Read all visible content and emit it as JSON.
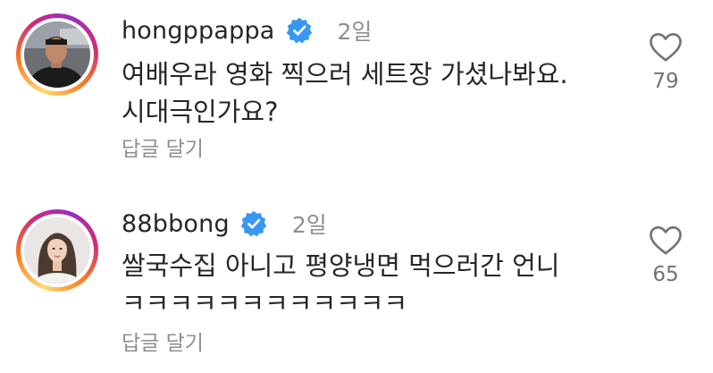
{
  "comments": [
    {
      "username": "hongppappa",
      "verified_icon": "verified-badge-icon",
      "time": "2일",
      "text_line1": "여배우라 영화 찍으러 세트장 가셨나봐요.",
      "text_line2": "시대극인가요?",
      "reply_label": "답글 달기",
      "like_icon": "heart-icon",
      "likes": "79"
    },
    {
      "username": "88bbong",
      "verified_icon": "verified-badge-icon",
      "time": "2일",
      "text_line1": "쌀국수집 아니고 평양냉면 먹으러간 언니",
      "text_line2": "ㅋㅋㅋㅋㅋㅋㅋㅋㅋㅋㅋㅋ",
      "reply_label": "답글 달기",
      "like_icon": "heart-icon",
      "likes": "65"
    }
  ],
  "colors": {
    "verified_blue": "#3897f0",
    "text": "#262626",
    "secondary": "#8e8e8e"
  }
}
